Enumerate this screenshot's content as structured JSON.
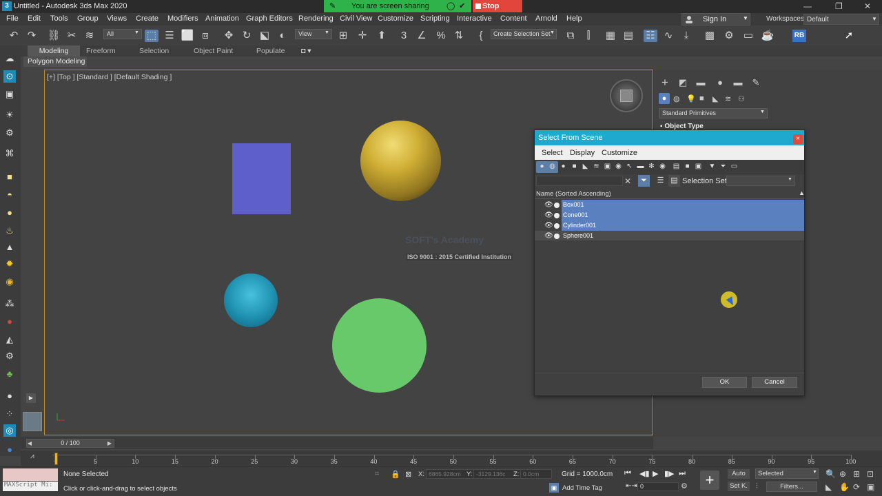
{
  "title": "Untitled - Autodesk 3ds Max 2020",
  "app_icon": "3",
  "share_bar": {
    "message": "You are screen sharing",
    "stop_label": "Stop Share",
    "color": "#2fb24a",
    "stop_color": "#e2453c"
  },
  "menu": [
    "File",
    "Edit",
    "Tools",
    "Group",
    "Views",
    "Create",
    "Modifiers",
    "Animation",
    "Graph Editors",
    "Rendering",
    "Civil View",
    "Customize",
    "Scripting",
    "Interactive",
    "Content",
    "Arnold",
    "Help"
  ],
  "signin": "Sign In",
  "workspaces_label": "Workspaces:",
  "workspaces_value": "Default",
  "toolbar": {
    "filter": "All",
    "ref_coord": "View",
    "create_selection_set": "Create Selection Set"
  },
  "ribbon_tabs": [
    "Modeling",
    "Freeform",
    "Selection",
    "Object Paint",
    "Populate"
  ],
  "ribbon_sub": "Polygon Modeling",
  "viewport_label": "[+] [Top ] [Standard ] [Default Shading ]",
  "watermark": {
    "line1": "SOFT's Academy",
    "line2": "ISO 9001 : 2015 Certified Institution"
  },
  "command_panel": {
    "dropdown": "Standard Primitives",
    "rollout": "Object Type"
  },
  "dialog": {
    "title": "Select From Scene",
    "close": "×",
    "menu": [
      "Select",
      "Display",
      "Customize"
    ],
    "selection_set_label": "Selection Set:",
    "column_header": "Name (Sorted Ascending)",
    "rows": [
      {
        "name": "Box001",
        "selected": true
      },
      {
        "name": "Cone001",
        "selected": true
      },
      {
        "name": "Cylinder001",
        "selected": true
      },
      {
        "name": "Sphere001",
        "selected": false
      }
    ],
    "ok": "OK",
    "cancel": "Cancel",
    "accent_color": "#1fa9ce",
    "selection_color": "#5b80bf"
  },
  "time_slider": "0 / 100",
  "timeline_ticks": [
    "0",
    "5",
    "10",
    "15",
    "20",
    "25",
    "30",
    "35",
    "40",
    "45",
    "50",
    "55",
    "60",
    "65",
    "70",
    "75",
    "80",
    "85",
    "90",
    "95",
    "100"
  ],
  "status": {
    "maxscript": "MAXScript Mi:",
    "selection": "None Selected",
    "prompt": "Click or click-and-drag to select objects",
    "x_label": "X:",
    "x_value": "6865.928cm",
    "y_label": "Y:",
    "y_value": "-3129.136c",
    "z_label": "Z:",
    "z_value": "0.0cm",
    "grid": "Grid = 1000.0cm",
    "add_time_tag": "Add Time Tag",
    "auto": "Auto",
    "set_key": "Set K.",
    "key_filter": "Selected",
    "filters": "Filters...",
    "frame": "0"
  },
  "objects": [
    {
      "name": "Box001",
      "color": "#5f5fcb"
    },
    {
      "name": "Sphere001",
      "color": "#cfae34"
    },
    {
      "name": "Cone001",
      "color": "#1f8fb0"
    },
    {
      "name": "Cylinder001",
      "color": "#68c96a"
    }
  ]
}
